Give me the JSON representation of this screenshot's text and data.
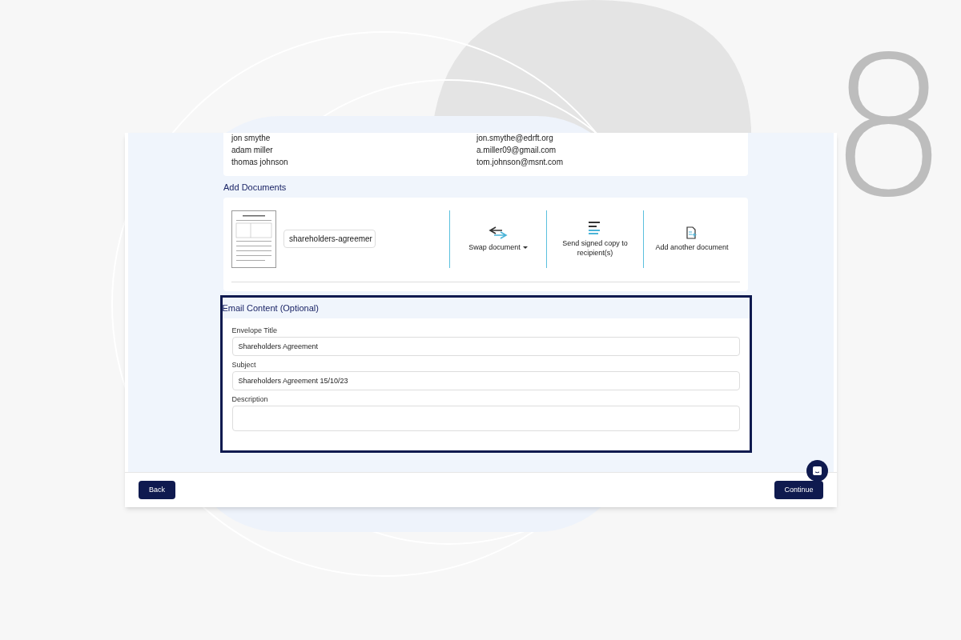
{
  "decor_number": "8",
  "recipients": [
    {
      "name": "jon smythe",
      "email": "jon.smythe@edrft.org"
    },
    {
      "name": "adam miller",
      "email": "a.miller09@gmail.com"
    },
    {
      "name": "thomas johnson",
      "email": "tom.johnson@msnt.com"
    }
  ],
  "documents": {
    "heading": "Add Documents",
    "file_name": "shareholders-agreemer",
    "actions": [
      {
        "kind": "swap",
        "label": "Swap document",
        "dropdown": true
      },
      {
        "kind": "send",
        "label": "Send signed copy to recipient(s)",
        "dropdown": false
      },
      {
        "kind": "add",
        "label": "Add another document",
        "dropdown": false
      }
    ]
  },
  "email_content": {
    "heading": "Email Content (Optional)",
    "highlighted": true,
    "fields": [
      {
        "label": "Envelope Title",
        "value": "Shareholders Agreement"
      },
      {
        "label": "Subject",
        "value": "Shareholders Agreement 15/10/23"
      },
      {
        "label": "Description"
      }
    ]
  },
  "footer": {
    "back": "Back",
    "continue": "Continue"
  }
}
